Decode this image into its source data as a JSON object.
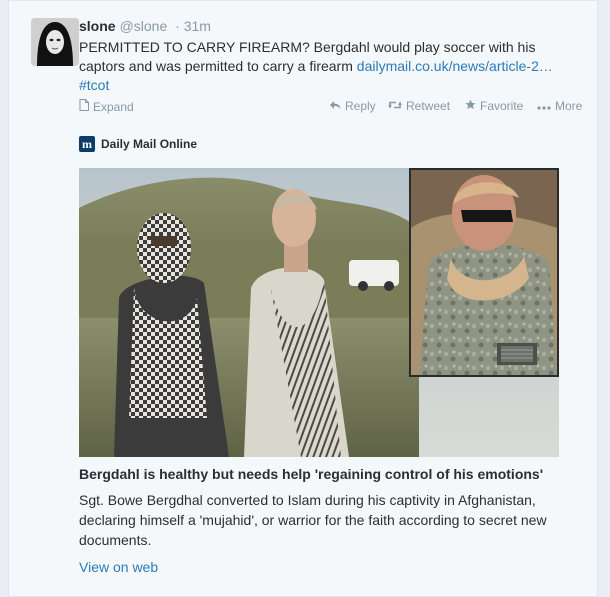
{
  "tweet": {
    "name": "slone",
    "handle": "@slone",
    "time": "· 31m",
    "text_plain": "PERMITTED TO CARRY FIREARM? Bergdahl would play soccer with his captors and was permitted to carry a firearm ",
    "link_text": "dailymail.co.uk/news/article-2…",
    "hashtag": "#tcot"
  },
  "actions": {
    "expand": "Expand",
    "reply": "Reply",
    "retweet": "Retweet",
    "favorite": "Favorite",
    "more": "More"
  },
  "card": {
    "source_logo": "m",
    "source_name": "Daily Mail Online",
    "headline": "Bergdahl is healthy but needs help 'regaining control of his emotions'",
    "summary": "Sgt. Bowe Bergdhal converted to Islam during his captivity in Afghanistan, declaring himself a 'mujahid', or warrior for the faith according to secret new documents.",
    "view_link": "View on web"
  },
  "icons": {
    "expand": "document-icon",
    "reply": "reply-arrow-icon",
    "retweet": "retweet-icon",
    "favorite": "star-icon",
    "more": "ellipsis-icon"
  },
  "colors": {
    "link": "#2b7bb9",
    "muted": "#8899a6",
    "text": "#292f33",
    "card_bg": "#f5f8fa",
    "dm_brand": "#0c3c6b"
  }
}
